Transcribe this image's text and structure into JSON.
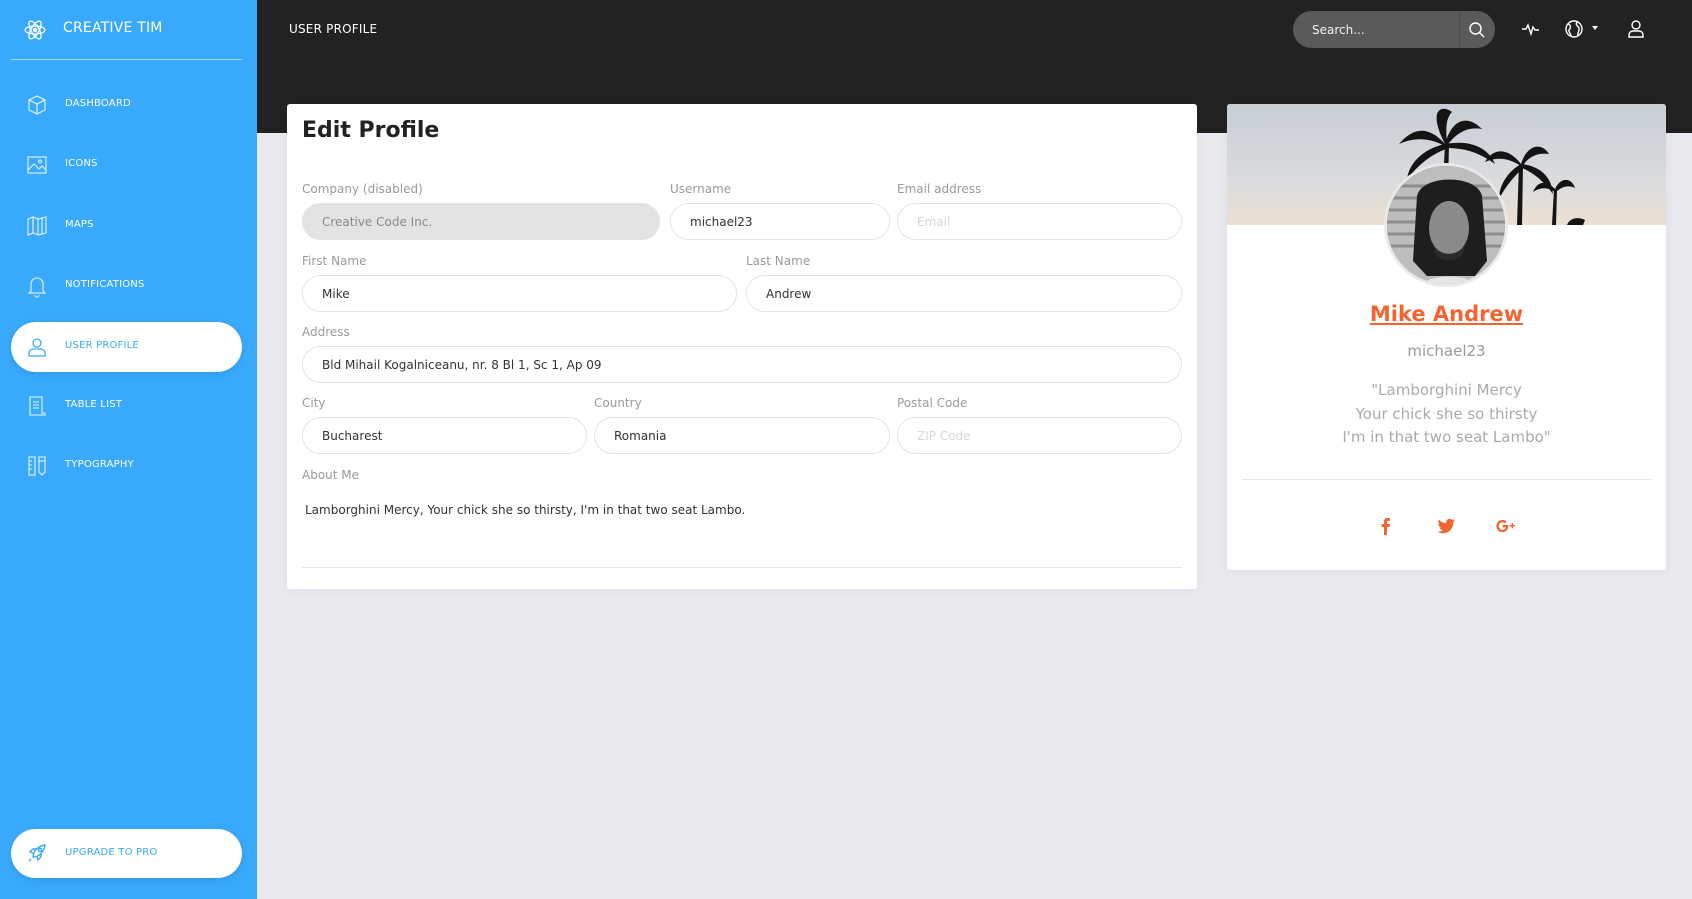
{
  "sidebar": {
    "logo_text": "CREATIVE TIM",
    "items": [
      {
        "label": "DASHBOARD",
        "icon": "cube-icon"
      },
      {
        "label": "ICONS",
        "icon": "image-icon"
      },
      {
        "label": "MAPS",
        "icon": "map-icon"
      },
      {
        "label": "NOTIFICATIONS",
        "icon": "bell-icon"
      },
      {
        "label": "USER PROFILE",
        "icon": "user-icon",
        "active": true
      },
      {
        "label": "TABLE LIST",
        "icon": "document-icon"
      },
      {
        "label": "TYPOGRAPHY",
        "icon": "ruler-pencil-icon"
      }
    ],
    "upgrade_label": "UPGRADE TO PRO"
  },
  "header": {
    "title": "USER PROFILE",
    "search_placeholder": "Search..."
  },
  "edit_profile": {
    "title": "Edit Profile",
    "fields": {
      "company": {
        "label": "Company (disabled)",
        "value": "Creative Code Inc.",
        "disabled": true
      },
      "username": {
        "label": "Username",
        "value": "michael23"
      },
      "email": {
        "label": "Email address",
        "value": "",
        "placeholder": "Email"
      },
      "first_name": {
        "label": "First Name",
        "value": "Mike"
      },
      "last_name": {
        "label": "Last Name",
        "value": "Andrew"
      },
      "address": {
        "label": "Address",
        "value": "Bld Mihail Kogalniceanu, nr. 8 Bl 1, Sc 1, Ap 09"
      },
      "city": {
        "label": "City",
        "value": "Bucharest"
      },
      "country": {
        "label": "Country",
        "value": "Romania"
      },
      "postal_code": {
        "label": "Postal Code",
        "value": "",
        "placeholder": "ZIP Code"
      },
      "about": {
        "label": "About Me",
        "value": "Lamborghini Mercy, Your chick she so thirsty, I'm in that two seat Lambo."
      }
    }
  },
  "profile_card": {
    "name": "Mike Andrew",
    "username": "michael23",
    "quote_lines": [
      "\"Lamborghini Mercy",
      "Your chick she so thirsty",
      "I'm in that two seat Lambo\""
    ],
    "social": [
      "facebook-icon",
      "twitter-icon",
      "google-plus-icon"
    ]
  },
  "colors": {
    "sidebar": "#38a9fb",
    "header": "#222222",
    "accent": "#f26531",
    "background": "#e9eaef"
  }
}
